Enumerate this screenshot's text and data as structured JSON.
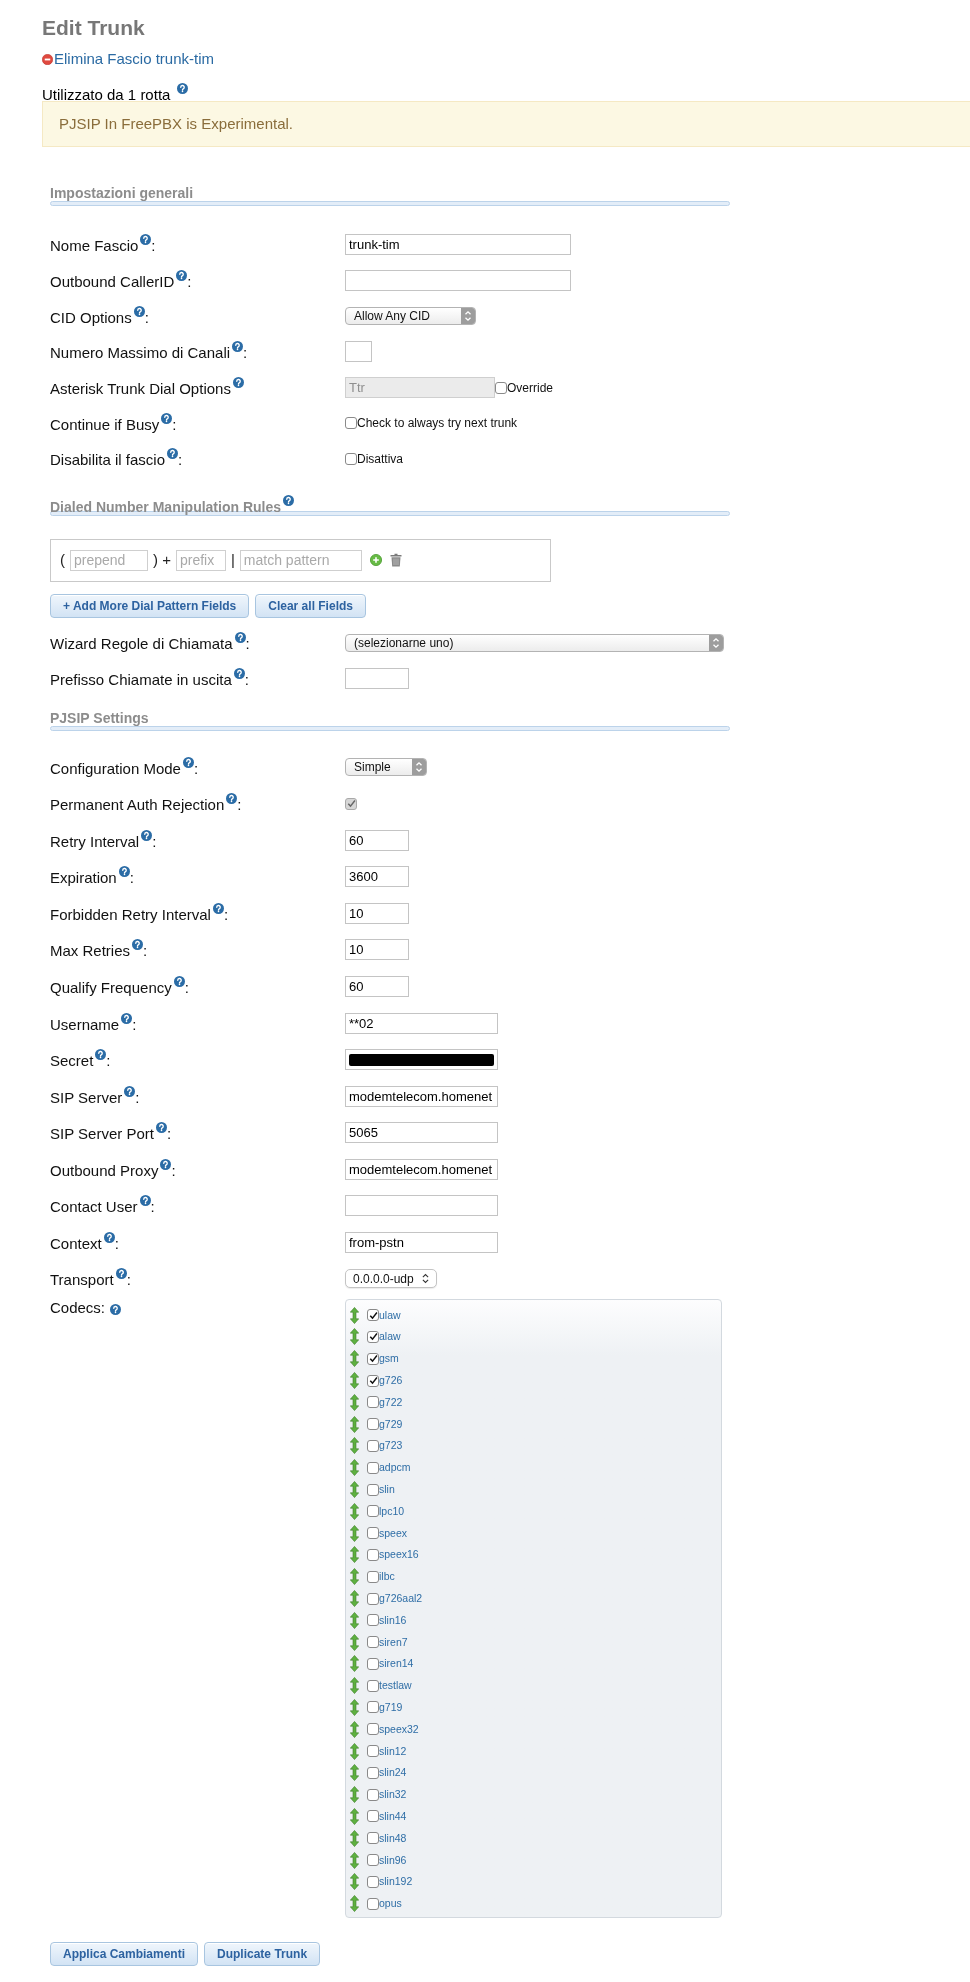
{
  "page": {
    "title": "Edit Trunk",
    "delete_link": "Elimina Fascio trunk-tim",
    "usage": {
      "text": "Utilizzato da 1 rotta",
      "help": true
    },
    "notice": "PJSIP In FreePBX is Experimental."
  },
  "sections": [
    {
      "title": "Impostazioni generali",
      "fields": [
        {
          "kind": "text",
          "label": "Nome Fascio",
          "help": true,
          "suffix": ":",
          "value": "trunk-tim",
          "disabled": false
        },
        {
          "kind": "text",
          "label": "Outbound CallerID",
          "help": true,
          "suffix": ":",
          "disabled": false
        },
        {
          "kind": "select",
          "label": "CID Options",
          "help": true,
          "suffix": ":",
          "value": "Allow Any CID",
          "disabled": false
        },
        {
          "kind": "number",
          "label": "Numero Massimo di Canali",
          "help": true,
          "suffix": ":",
          "disabled": false
        },
        {
          "kind": "override",
          "label": "Asterisk Trunk Dial Options",
          "help": true,
          "value": "Ttr",
          "disabled": true,
          "override": {
            "label": "Override",
            "checked": false
          }
        },
        {
          "kind": "checkbox",
          "label": "Continue if Busy",
          "help": true,
          "suffix": ":",
          "option": "Check to always try next trunk",
          "checked": false,
          "disabled": false
        },
        {
          "kind": "checkbox",
          "label": "Disabilita il fascio",
          "help": true,
          "suffix": ":",
          "option": "Disattiva",
          "checked": false,
          "disabled": false
        }
      ]
    },
    {
      "title": "Dialed Number Manipulation Rules",
      "help": true,
      "rules": [
        {
          "parts": [
            {
              "kind": "text",
              "text": "("
            },
            {
              "kind": "input",
              "placeholder": "prepend"
            },
            {
              "kind": "text",
              "text": ") +"
            },
            {
              "kind": "input",
              "placeholder": "prefix"
            },
            {
              "kind": "text",
              "text": "|"
            },
            {
              "kind": "input",
              "placeholder": "match pattern"
            }
          ]
        }
      ],
      "buttons": [
        "+ Add More Dial Pattern Fields",
        "Clear all Fields"
      ],
      "fields": [
        {
          "kind": "select",
          "label": "Wizard Regole di Chiamata",
          "help": true,
          "suffix": ":",
          "value": "(selezionarne uno)",
          "disabled": false
        },
        {
          "kind": "number",
          "label": "Prefisso Chiamate in uscita",
          "help": true,
          "suffix": ":",
          "disabled": false
        }
      ]
    },
    {
      "title": "PJSIP Settings",
      "fields": [
        {
          "kind": "select",
          "label": "Configuration Mode",
          "help": true,
          "suffix": ":",
          "value": "Simple",
          "disabled": false
        },
        {
          "kind": "checkbox",
          "label": "Permanent Auth Rejection",
          "help": true,
          "suffix": ":",
          "checked": true,
          "disabled": true
        },
        {
          "kind": "number",
          "label": "Retry Interval",
          "help": true,
          "suffix": ":",
          "value": "60",
          "disabled": false
        },
        {
          "kind": "number",
          "label": "Expiration",
          "help": true,
          "suffix": ":",
          "value": "3600",
          "disabled": false
        },
        {
          "kind": "number",
          "label": "Forbidden Retry Interval",
          "help": true,
          "suffix": ":",
          "value": "10",
          "disabled": false
        },
        {
          "kind": "number",
          "label": "Max Retries",
          "help": true,
          "suffix": ":",
          "value": "10",
          "disabled": false
        },
        {
          "kind": "number",
          "label": "Qualify Frequency",
          "help": true,
          "suffix": ":",
          "value": "60",
          "disabled": false
        },
        {
          "kind": "text",
          "label": "Username",
          "help": true,
          "suffix": ":",
          "value": "**02",
          "disabled": false
        },
        {
          "kind": "redacted",
          "label": "Secret",
          "help": true,
          "suffix": ":",
          "disabled": false
        },
        {
          "kind": "text",
          "label": "SIP Server",
          "help": true,
          "suffix": ":",
          "value": "modemtelecom.homenet",
          "disabled": false
        },
        {
          "kind": "text",
          "label": "SIP Server Port",
          "help": true,
          "suffix": ":",
          "value": "5065",
          "disabled": false
        },
        {
          "kind": "text",
          "label": "Outbound Proxy",
          "help": true,
          "suffix": ":",
          "value": "modemtelecom.homenet",
          "disabled": false
        },
        {
          "kind": "text",
          "label": "Contact User",
          "help": true,
          "suffix": ":",
          "disabled": false
        },
        {
          "kind": "text",
          "label": "Context",
          "help": true,
          "suffix": ":",
          "value": "from-pstn",
          "disabled": false
        },
        {
          "kind": "popup",
          "label": "Transport",
          "help": true,
          "suffix": ":",
          "value": "0.0.0.0-udp",
          "disabled": false
        },
        {
          "kind": "codecs",
          "label": "Codecs:",
          "help": true,
          "codecs": [
            {
              "name": "ulaw",
              "checked": true
            },
            {
              "name": "alaw",
              "checked": true
            },
            {
              "name": "gsm",
              "checked": true
            },
            {
              "name": "g726",
              "checked": true
            },
            {
              "name": "g722",
              "checked": false
            },
            {
              "name": "g729",
              "checked": false
            },
            {
              "name": "g723",
              "checked": false
            },
            {
              "name": "adpcm",
              "checked": false
            },
            {
              "name": "slin",
              "checked": false
            },
            {
              "name": "lpc10",
              "checked": false
            },
            {
              "name": "speex",
              "checked": false
            },
            {
              "name": "speex16",
              "checked": false
            },
            {
              "name": "ilbc",
              "checked": false
            },
            {
              "name": "g726aal2",
              "checked": false
            },
            {
              "name": "slin16",
              "checked": false
            },
            {
              "name": "siren7",
              "checked": false
            },
            {
              "name": "siren14",
              "checked": false
            },
            {
              "name": "testlaw",
              "checked": false
            },
            {
              "name": "g719",
              "checked": false
            },
            {
              "name": "speex32",
              "checked": false
            },
            {
              "name": "slin12",
              "checked": false
            },
            {
              "name": "slin24",
              "checked": false
            },
            {
              "name": "slin32",
              "checked": false
            },
            {
              "name": "slin44",
              "checked": false
            },
            {
              "name": "slin48",
              "checked": false
            },
            {
              "name": "slin96",
              "checked": false
            },
            {
              "name": "slin192",
              "checked": false
            },
            {
              "name": "opus",
              "checked": false
            }
          ]
        }
      ]
    }
  ],
  "buttons": [
    "Applica Cambiamenti",
    "Duplicate Trunk"
  ]
}
